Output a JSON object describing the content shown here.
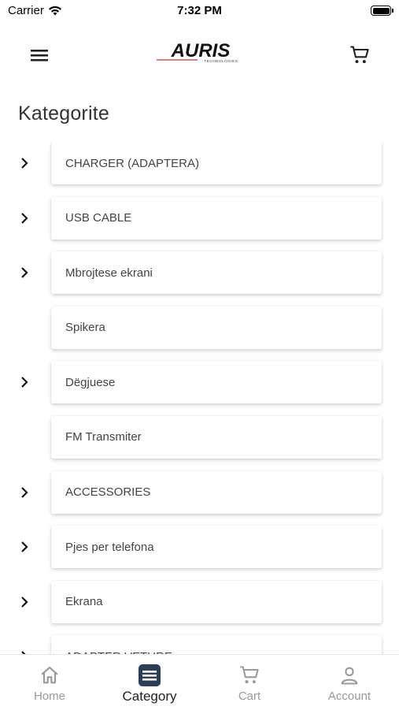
{
  "status_bar": {
    "carrier": "Carrier",
    "time": "7:32 PM"
  },
  "header": {
    "brand_name": "AURIS",
    "brand_sub": "TECHNOLOGIES"
  },
  "page": {
    "title": "Kategorite"
  },
  "categories": [
    {
      "label": "CHARGER (ADAPTERA)",
      "has_children": true
    },
    {
      "label": "USB CABLE",
      "has_children": true
    },
    {
      "label": "Mbrojtese ekrani",
      "has_children": true
    },
    {
      "label": "Spikera",
      "has_children": false
    },
    {
      "label": "Dëgjuese",
      "has_children": true
    },
    {
      "label": "FM Transmiter",
      "has_children": false
    },
    {
      "label": "ACCESSORIES",
      "has_children": true
    },
    {
      "label": "Pjes per telefona",
      "has_children": true
    },
    {
      "label": "Ekrana",
      "has_children": true
    },
    {
      "label": "ADAPTER VETURE",
      "has_children": true
    }
  ],
  "tabs": [
    {
      "label": "Home",
      "icon": "home-icon",
      "active": false
    },
    {
      "label": "Category",
      "icon": "category-icon",
      "active": true
    },
    {
      "label": "Cart",
      "icon": "cart-icon",
      "active": false
    },
    {
      "label": "Account",
      "icon": "account-icon",
      "active": false
    }
  ],
  "colors": {
    "accent": "#2b3e55",
    "inactive": "#9a9a9a",
    "text": "#444444"
  }
}
